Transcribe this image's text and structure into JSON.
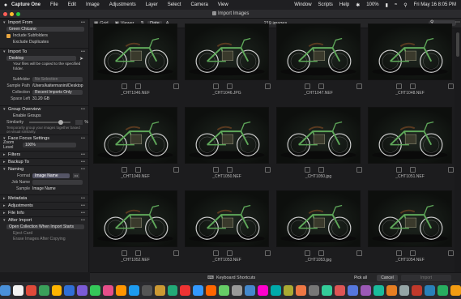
{
  "menubar": {
    "apple": "",
    "app": "Capture One",
    "items": [
      "File",
      "Edit",
      "Image",
      "Adjustments",
      "Layer",
      "Select",
      "Camera",
      "View"
    ],
    "right_items": [
      "Window",
      "Scripts",
      "Help"
    ],
    "battery": "100%",
    "datetime": "Fri May 16  8:05 PM"
  },
  "window": {
    "title": "Import Images"
  },
  "left_panel": {
    "import_from": {
      "title": "Import From",
      "source": "Green Chicano",
      "include_subfolders": "Include Subfolders",
      "exclude_duplicates": "Exclude Duplicates"
    },
    "import_to": {
      "title": "Import To",
      "destination": "Desktop",
      "note": "Your files will be copied to the specified folder.",
      "subfolder_label": "Subfolder",
      "subfolder_placeholder": "No Selection",
      "sample_path_label": "Sample Path",
      "sample_path": "/Users/kaitermanini/Desktop",
      "collection_label": "Collection",
      "collection": "Recent Imports Only",
      "space_left_label": "Space Left",
      "space_left": "31.20 GB"
    },
    "group_overview": {
      "title": "Group Overview",
      "enable_groups": "Enable Groups",
      "similarity_label": "Similarity",
      "similarity_value": "%",
      "note": "Temporarily group your images together based on visual similarity."
    },
    "face_focus": {
      "title": "Face Focus Settings",
      "zoom_label": "Zoom Level",
      "zoom_value": "100%"
    },
    "filters": {
      "title": "Filters"
    },
    "backup_to": {
      "title": "Backup To"
    },
    "naming": {
      "title": "Naming",
      "format_label": "Format",
      "format_value": "Image Name",
      "job_name_label": "Job Name",
      "sample_label": "Sample",
      "sample_value": "Image Name"
    },
    "metadata": {
      "title": "Metadata"
    },
    "adjustments": {
      "title": "Adjustments"
    },
    "file_info": {
      "title": "File Info"
    },
    "after_import": {
      "title": "After Import",
      "action": "Open Collection When Import Starts",
      "eject_card": "Eject Card",
      "erase": "Erase Images After Copying"
    }
  },
  "toolbar": {
    "grid_label": "Grid",
    "viewer_label": "Viewer",
    "sort_label": "Date",
    "image_count": "219 images"
  },
  "grid": {
    "rows": [
      [
        "_CHT1046.NEF",
        "_CHT1046.JPG",
        "_CHT1047.NEF",
        "_CHT1048.NEF"
      ],
      [
        "_CHT1049.NEF",
        "_CHT1050.NEF",
        "_CHT1050.jpg",
        "_CHT1051.NEF"
      ],
      [
        "_CHT1052.NEF",
        "_CHT1053.NEF",
        "_CHT1053.jpg",
        "_CHT1054.NEF"
      ]
    ]
  },
  "bottombar": {
    "keyboard_shortcuts": "Keyboard Shortcuts",
    "pick_all": "Pick all",
    "cancel": "Cancel",
    "import": "Import"
  },
  "colors": {
    "accent": "#e8a640",
    "bike_green": "#5fa85a",
    "dock_icons": [
      "#4a90d9",
      "#f2f2f2",
      "#e04a3a",
      "#3aa05a",
      "#ffb400",
      "#2f6fd6",
      "#7b5bd6",
      "#34c759",
      "#e54e8a",
      "#ff9500",
      "#1d9bf0",
      "#555",
      "#c93",
      "#2a7",
      "#e33",
      "#39f",
      "#f60",
      "#6c6",
      "#999",
      "#48c",
      "#f0c",
      "#0aa",
      "#aa3",
      "#e74",
      "#777",
      "#3c9",
      "#d55",
      "#57d",
      "#9b59b6",
      "#1abc9c",
      "#e67e22",
      "#95a5a6",
      "#c0392b",
      "#2980b9",
      "#27ae60",
      "#f39c12"
    ]
  }
}
